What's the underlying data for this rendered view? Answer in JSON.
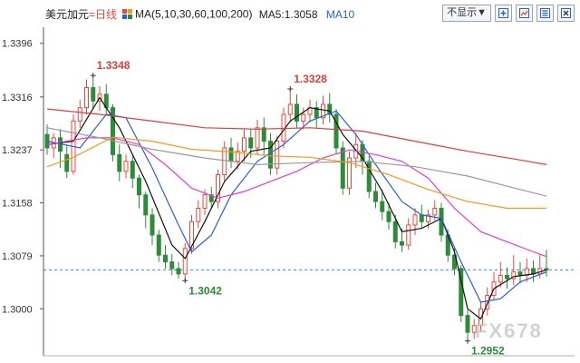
{
  "header": {
    "symbol": "美元加元",
    "period": "=日线",
    "ma_label": "MA(5,10,30,60,100,200)",
    "ma5_label": "MA5:1.3058",
    "ma10_label": "MA10",
    "hide_label": "不显示▼"
  },
  "watermark": "FX678",
  "colors": {
    "up": "#e8483a",
    "down": "#2e8b3a",
    "ma5": "#111111",
    "ma10": "#2a5fd8",
    "ma30": "#e040c8",
    "ma60": "#9a9a9a",
    "ma100": "#f39a1e",
    "ma200": "#d94040",
    "current": "#2a8fd8",
    "high_label": "#d94040",
    "low_label": "#2e8b3a"
  },
  "chart_data": {
    "type": "candlestick",
    "y_ticks": [
      "1.3396",
      "1.3316",
      "1.3237",
      "1.3158",
      "1.3079",
      "1.3000"
    ],
    "ylim": [
      1.293,
      1.342
    ],
    "current_price": 1.3058,
    "annotations": [
      {
        "text": "1.3348",
        "index": 7,
        "value": 1.3348,
        "kind": "high"
      },
      {
        "text": "1.3328",
        "index": 37,
        "value": 1.3328,
        "kind": "high"
      },
      {
        "text": "1.3042",
        "index": 21,
        "value": 1.3042,
        "kind": "low"
      },
      {
        "text": "1.2952",
        "index": 64,
        "value": 1.2952,
        "kind": "low"
      }
    ],
    "candles": [
      [
        1.326,
        1.324,
        1.3275,
        1.323
      ],
      [
        1.324,
        1.3255,
        1.3262,
        1.3225
      ],
      [
        1.3255,
        1.3235,
        1.3268,
        1.321
      ],
      [
        1.323,
        1.3205,
        1.3245,
        1.3195
      ],
      [
        1.3205,
        1.328,
        1.329,
        1.32
      ],
      [
        1.328,
        1.33,
        1.3312,
        1.327
      ],
      [
        1.33,
        1.333,
        1.3342,
        1.329
      ],
      [
        1.333,
        1.331,
        1.3348,
        1.3298
      ],
      [
        1.331,
        1.332,
        1.3332,
        1.3295
      ],
      [
        1.332,
        1.33,
        1.3335,
        1.329
      ],
      [
        1.33,
        1.323,
        1.3305,
        1.322
      ],
      [
        1.323,
        1.3205,
        1.3245,
        1.319
      ],
      [
        1.3205,
        1.322,
        1.323,
        1.3195
      ],
      [
        1.322,
        1.3195,
        1.3228,
        1.318
      ],
      [
        1.3195,
        1.317,
        1.32,
        1.315
      ],
      [
        1.317,
        1.314,
        1.3175,
        1.312
      ],
      [
        1.314,
        1.311,
        1.315,
        1.3095
      ],
      [
        1.311,
        1.308,
        1.3118,
        1.307
      ],
      [
        1.308,
        1.307,
        1.3095,
        1.306
      ],
      [
        1.307,
        1.306,
        1.3082,
        1.305
      ],
      [
        1.306,
        1.3052,
        1.307,
        1.3045
      ],
      [
        1.3052,
        1.309,
        1.3098,
        1.3042
      ],
      [
        1.309,
        1.313,
        1.314,
        1.3082
      ],
      [
        1.313,
        1.315,
        1.3162,
        1.312
      ],
      [
        1.315,
        1.317,
        1.3178,
        1.314
      ],
      [
        1.317,
        1.316,
        1.3182,
        1.315
      ],
      [
        1.316,
        1.32,
        1.3208,
        1.315
      ],
      [
        1.32,
        1.324,
        1.325,
        1.319
      ],
      [
        1.324,
        1.322,
        1.3255,
        1.321
      ],
      [
        1.322,
        1.3235,
        1.3248,
        1.3208
      ],
      [
        1.3235,
        1.3255,
        1.3268,
        1.322
      ],
      [
        1.3255,
        1.324,
        1.3268,
        1.3225
      ],
      [
        1.324,
        1.327,
        1.3282,
        1.323
      ],
      [
        1.327,
        1.325,
        1.3285,
        1.323
      ],
      [
        1.325,
        1.321,
        1.3262,
        1.32
      ],
      [
        1.321,
        1.325,
        1.3258,
        1.32
      ],
      [
        1.325,
        1.329,
        1.33,
        1.324
      ],
      [
        1.329,
        1.3305,
        1.3328,
        1.328
      ],
      [
        1.3305,
        1.328,
        1.332,
        1.327
      ],
      [
        1.328,
        1.329,
        1.33,
        1.3268
      ],
      [
        1.329,
        1.33,
        1.3312,
        1.3278
      ],
      [
        1.33,
        1.3285,
        1.331,
        1.327
      ],
      [
        1.3285,
        1.3305,
        1.3318,
        1.3275
      ],
      [
        1.3305,
        1.329,
        1.3322,
        1.3278
      ],
      [
        1.329,
        1.324,
        1.3298,
        1.323
      ],
      [
        1.324,
        1.318,
        1.325,
        1.317
      ],
      [
        1.318,
        1.3225,
        1.3235,
        1.317
      ],
      [
        1.3225,
        1.3245,
        1.3262,
        1.321
      ],
      [
        1.3245,
        1.322,
        1.3252,
        1.32
      ],
      [
        1.322,
        1.3175,
        1.3228,
        1.3165
      ],
      [
        1.3175,
        1.316,
        1.3188,
        1.315
      ],
      [
        1.316,
        1.3145,
        1.3178,
        1.3132
      ],
      [
        1.3145,
        1.313,
        1.3158,
        1.3118
      ],
      [
        1.313,
        1.31,
        1.314,
        1.309
      ],
      [
        1.31,
        1.3095,
        1.312,
        1.3085
      ],
      [
        1.3095,
        1.3125,
        1.3135,
        1.3088
      ],
      [
        1.3125,
        1.314,
        1.315,
        1.311
      ],
      [
        1.314,
        1.313,
        1.3155,
        1.312
      ],
      [
        1.313,
        1.314,
        1.3148,
        1.312
      ],
      [
        1.314,
        1.315,
        1.3162,
        1.3132
      ],
      [
        1.315,
        1.311,
        1.3158,
        1.31
      ],
      [
        1.311,
        1.308,
        1.3118,
        1.307
      ],
      [
        1.308,
        1.306,
        1.309,
        1.305
      ],
      [
        1.306,
        1.299,
        1.3065,
        1.298
      ],
      [
        1.299,
        1.2965,
        1.2998,
        1.2952
      ],
      [
        1.2965,
        1.2975,
        1.2985,
        1.2955
      ],
      [
        1.2975,
        1.3,
        1.301,
        1.2965
      ],
      [
        1.3,
        1.302,
        1.3032,
        1.299
      ],
      [
        1.302,
        1.304,
        1.3055,
        1.3012
      ],
      [
        1.304,
        1.305,
        1.307,
        1.3032
      ],
      [
        1.305,
        1.3045,
        1.3062,
        1.303
      ],
      [
        1.3045,
        1.3055,
        1.308,
        1.3035
      ],
      [
        1.3055,
        1.305,
        1.307,
        1.3038
      ],
      [
        1.305,
        1.306,
        1.3075,
        1.304
      ],
      [
        1.306,
        1.3052,
        1.3072,
        1.304
      ],
      [
        1.3052,
        1.306,
        1.3082,
        1.3045
      ],
      [
        1.306,
        1.3058,
        1.3088,
        1.3048
      ]
    ],
    "ma_lines": [
      {
        "name": "MA5",
        "color_key": "ma5",
        "points": [
          [
            0,
            1.3245
          ],
          [
            4,
            1.325
          ],
          [
            8,
            1.3315
          ],
          [
            11,
            1.327
          ],
          [
            15,
            1.319
          ],
          [
            19,
            1.3095
          ],
          [
            21,
            1.3075
          ],
          [
            24,
            1.313
          ],
          [
            27,
            1.319
          ],
          [
            31,
            1.3235
          ],
          [
            34,
            1.324
          ],
          [
            37,
            1.328
          ],
          [
            40,
            1.33
          ],
          [
            43,
            1.3295
          ],
          [
            45,
            1.326
          ],
          [
            48,
            1.3225
          ],
          [
            51,
            1.3175
          ],
          [
            54,
            1.3115
          ],
          [
            57,
            1.312
          ],
          [
            60,
            1.3135
          ],
          [
            62,
            1.3085
          ],
          [
            64,
            1.3
          ],
          [
            66,
            1.2985
          ],
          [
            68,
            1.303
          ],
          [
            71,
            1.3048
          ],
          [
            74,
            1.3052
          ],
          [
            76,
            1.3058
          ]
        ]
      },
      {
        "name": "MA10",
        "color_key": "ma10",
        "points": [
          [
            0,
            1.325
          ],
          [
            5,
            1.324
          ],
          [
            9,
            1.329
          ],
          [
            12,
            1.3285
          ],
          [
            16,
            1.321
          ],
          [
            20,
            1.3125
          ],
          [
            22,
            1.3085
          ],
          [
            25,
            1.311
          ],
          [
            28,
            1.317
          ],
          [
            32,
            1.322
          ],
          [
            36,
            1.3245
          ],
          [
            40,
            1.328
          ],
          [
            44,
            1.3295
          ],
          [
            47,
            1.326
          ],
          [
            50,
            1.3215
          ],
          [
            54,
            1.316
          ],
          [
            57,
            1.314
          ],
          [
            60,
            1.3135
          ],
          [
            63,
            1.307
          ],
          [
            66,
            1.301
          ],
          [
            69,
            1.3015
          ],
          [
            72,
            1.304
          ],
          [
            76,
            1.3055
          ]
        ]
      },
      {
        "name": "MA30",
        "color_key": "ma30",
        "points": [
          [
            0,
            1.3245
          ],
          [
            6,
            1.3255
          ],
          [
            10,
            1.3255
          ],
          [
            14,
            1.3245
          ],
          [
            18,
            1.3215
          ],
          [
            22,
            1.318
          ],
          [
            26,
            1.3165
          ],
          [
            30,
            1.3175
          ],
          [
            34,
            1.319
          ],
          [
            38,
            1.3205
          ],
          [
            42,
            1.3225
          ],
          [
            46,
            1.3237
          ],
          [
            50,
            1.323
          ],
          [
            54,
            1.322
          ],
          [
            58,
            1.3195
          ],
          [
            62,
            1.315
          ],
          [
            66,
            1.3115
          ],
          [
            70,
            1.31
          ],
          [
            74,
            1.3085
          ],
          [
            76,
            1.3078
          ]
        ]
      },
      {
        "name": "MA60",
        "color_key": "ma60",
        "points": [
          [
            0,
            1.327
          ],
          [
            8,
            1.3255
          ],
          [
            16,
            1.3238
          ],
          [
            24,
            1.3225
          ],
          [
            32,
            1.3215
          ],
          [
            40,
            1.3218
          ],
          [
            48,
            1.322
          ],
          [
            56,
            1.3212
          ],
          [
            64,
            1.3198
          ],
          [
            72,
            1.3178
          ],
          [
            76,
            1.3168
          ]
        ]
      },
      {
        "name": "MA100",
        "color_key": "ma100",
        "points": [
          [
            0,
            1.3212
          ],
          [
            4,
            1.3226
          ],
          [
            10,
            1.3256
          ],
          [
            16,
            1.325
          ],
          [
            22,
            1.3238
          ],
          [
            28,
            1.3234
          ],
          [
            34,
            1.3228
          ],
          [
            40,
            1.3226
          ],
          [
            46,
            1.3218
          ],
          [
            52,
            1.32
          ],
          [
            58,
            1.3178
          ],
          [
            64,
            1.316
          ],
          [
            70,
            1.315
          ],
          [
            76,
            1.315
          ]
        ]
      },
      {
        "name": "MA200",
        "color_key": "ma200",
        "points": [
          [
            0,
            1.3298
          ],
          [
            8,
            1.329
          ],
          [
            16,
            1.328
          ],
          [
            24,
            1.327
          ],
          [
            32,
            1.3268
          ],
          [
            40,
            1.327
          ],
          [
            48,
            1.3265
          ],
          [
            56,
            1.325
          ],
          [
            64,
            1.3235
          ],
          [
            72,
            1.3222
          ],
          [
            76,
            1.3215
          ]
        ]
      }
    ]
  }
}
